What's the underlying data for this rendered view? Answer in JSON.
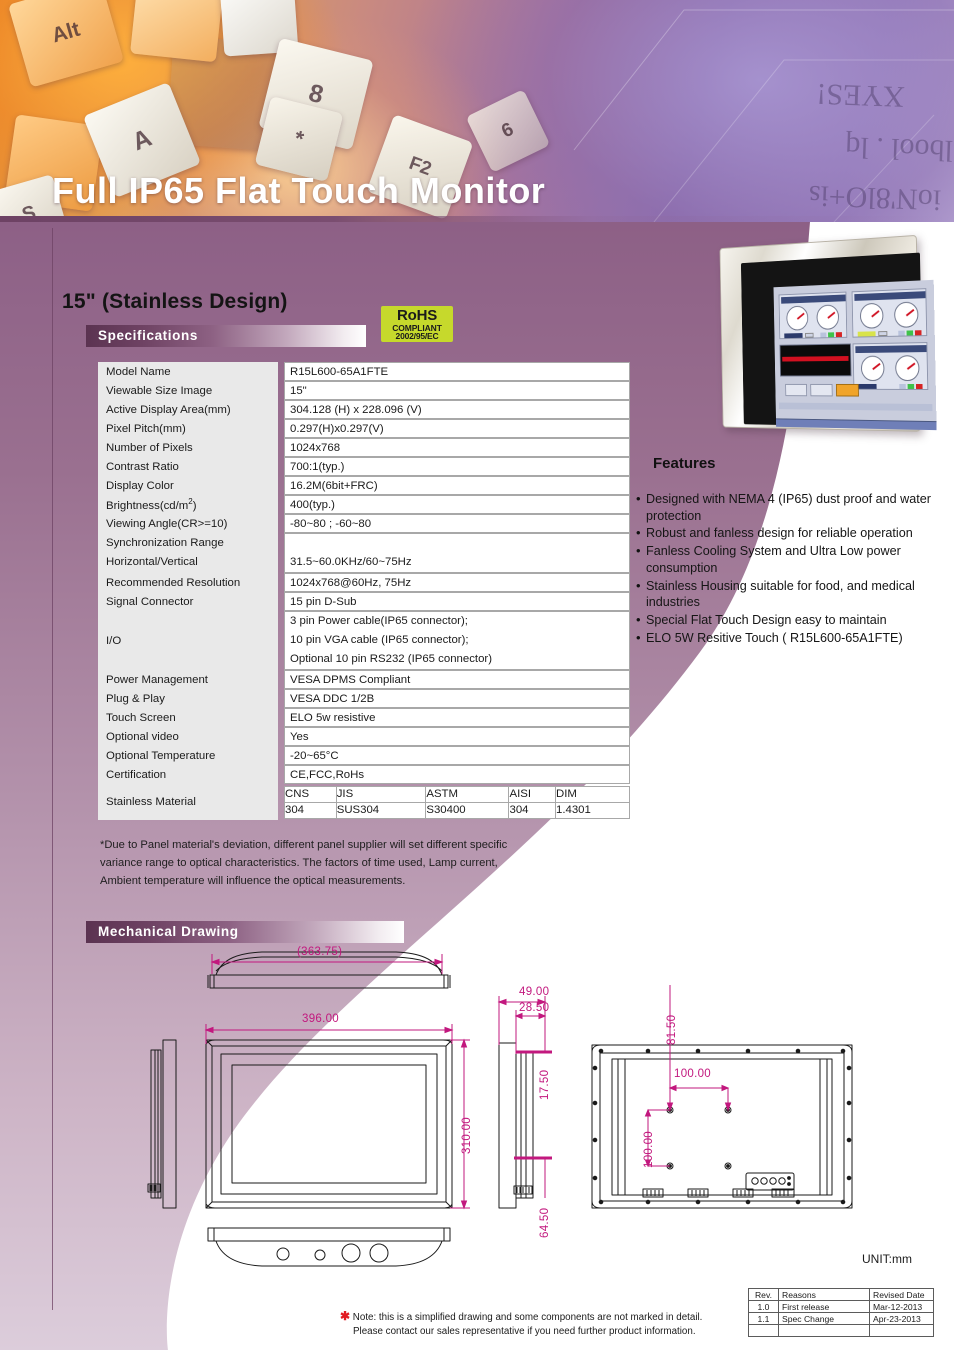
{
  "banner": {
    "title": "Full IP65 Flat Touch Monitor",
    "keycaps": [
      "Alt",
      "8",
      "*",
      "A",
      "F2",
      "6",
      "S"
    ]
  },
  "header": {
    "model_title": "15\" (Stainless Design)",
    "rohs": {
      "line1": "RoHS",
      "line2": "COMPLIANT",
      "line3": "2002/95/EC"
    }
  },
  "sections": {
    "specifications": "Specifications",
    "mechanical_drawing": "Mechanical Drawing"
  },
  "spec_rows": [
    {
      "label": "Model Name",
      "value": "R15L600-65A1FTE"
    },
    {
      "label": "Viewable Size Image",
      "value": "15\""
    },
    {
      "label": "Active Display Area(mm)",
      "value": "304.128 (H) x 228.096 (V)"
    },
    {
      "label": "Pixel Pitch(mm)",
      "value": "0.297(H)x0.297(V)"
    },
    {
      "label": "Number of Pixels",
      "value": "1024x768"
    },
    {
      "label": "Contrast Ratio",
      "value": "700:1(typ.)"
    },
    {
      "label": "Display Color",
      "value": "16.2M(6bit+FRC)"
    },
    {
      "label": "Brightness(cd/m",
      "label_sup": "2",
      "label_tail": ")",
      "value": "400(typ.)"
    },
    {
      "label": "Viewing Angle(CR>=10)",
      "value": "-80~80 ; -60~80"
    },
    {
      "label": "Synchronization Range",
      "label2": "Horizontal/Vertical",
      "value": "31.5~60.0KHz/60~75Hz"
    },
    {
      "label": "Recommended Resolution",
      "value": "1024x768@60Hz, 75Hz"
    },
    {
      "label": "Signal Connector",
      "value": "15 pin D-Sub"
    },
    {
      "label": "I/O",
      "value_lines": [
        "3 pin Power cable(IP65 connector);",
        "10 pin VGA cable (IP65 connector);",
        "Optional 10 pin RS232 (IP65 connector)"
      ]
    },
    {
      "label": "Power Management",
      "value": "VESA DPMS Compliant"
    },
    {
      "label": "Plug & Play",
      "value": "VESA DDC 1/2B"
    },
    {
      "label": "Touch Screen",
      "value": "ELO 5w resistive"
    },
    {
      "label": "Optional video",
      "value": "Yes"
    },
    {
      "label": "Optional  Temperature",
      "value": "-20~65°C"
    },
    {
      "label": "Certification",
      "value": "CE,FCC,RoHs"
    }
  ],
  "stainless_material": {
    "label": "Stainless Material",
    "headers": [
      "CNS",
      "JIS",
      "ASTM",
      "AISI",
      "DIM"
    ],
    "values": [
      "304",
      "SUS304",
      "S30400",
      "304",
      "1.4301"
    ]
  },
  "footnote": [
    "*Due to Panel material's deviation, different panel supplier will set different specific",
    "variance range to optical characteristics. The factors of time used, Lamp current,",
    "Ambient temperature will influence the optical measurements."
  ],
  "features": {
    "title": "Features",
    "items": [
      "Designed with NEMA 4 (IP65) dust proof and  water protection",
      "Robust and fanless design for reliable operation",
      "Fanless Cooling System and Ultra Low power consumption",
      "Stainless Housing suitable for food, and medical industries",
      "Special Flat Touch Design easy to maintain",
      "ELO 5W Resitive Touch ( R15L600-65A1FTE)"
    ]
  },
  "drawing": {
    "unit_label": "UNIT:mm",
    "dimensions": {
      "top_width": "(363.75)",
      "front_width": "396.00",
      "front_height": "310.00",
      "side_depth_total": "49.00",
      "side_depth_inner": "28.50",
      "side_top_offset": "17.50",
      "side_bottom_offset": "64.50",
      "rear_top_offset": "81.50",
      "vesa_horizontal": "100.00",
      "vesa_vertical": "100.00"
    }
  },
  "note": [
    "Note: this is a simplified drawing and some components are not marked in detail.",
    "Please contact our sales representative if you need further product information."
  ],
  "revision_table": {
    "headers": [
      "Rev.",
      "Reasons",
      "Revised Date"
    ],
    "rows": [
      [
        "1.0",
        "First release",
        "Mar-12-2013"
      ],
      [
        "1.1",
        "Spec Change",
        "Apr-23-2013"
      ],
      [
        "",
        "",
        ""
      ]
    ]
  },
  "colors": {
    "purple_dark": "#5b3351",
    "purple_mid": "#8d6086",
    "rohs_green": "#c6d92c",
    "dimension_magenta": "#c2187e",
    "note_star_red": "#e11b22"
  }
}
